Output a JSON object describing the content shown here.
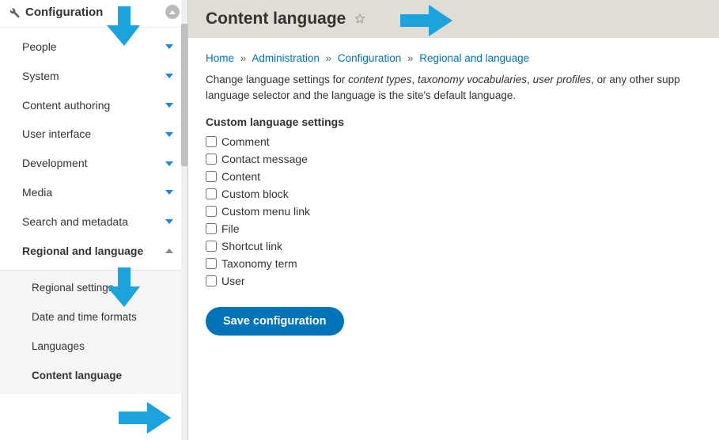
{
  "sidebar": {
    "title": "Configuration",
    "items": [
      {
        "label": "People"
      },
      {
        "label": "System"
      },
      {
        "label": "Content authoring"
      },
      {
        "label": "User interface"
      },
      {
        "label": "Development"
      },
      {
        "label": "Media"
      },
      {
        "label": "Search and metadata"
      },
      {
        "label": "Regional and language"
      }
    ],
    "sub": [
      {
        "label": "Regional settings"
      },
      {
        "label": "Date and time formats"
      },
      {
        "label": "Languages"
      },
      {
        "label": "Content language"
      }
    ]
  },
  "page": {
    "title": "Content language",
    "breadcrumb": {
      "home": "Home",
      "admin": "Administration",
      "config": "Configuration",
      "regional": "Regional and language",
      "sep": "»"
    },
    "desc_prefix": "Change language settings for ",
    "desc_em1": "content types",
    "desc_s1": ", ",
    "desc_em2": "taxonomy vocabularies",
    "desc_s2": ", ",
    "desc_em3": "user profiles",
    "desc_suffix": ", or any other supp",
    "desc_line2": "language selector and the language is the site's default language.",
    "section_title": "Custom language settings",
    "checks": [
      "Comment",
      "Contact message",
      "Content",
      "Custom block",
      "Custom menu link",
      "File",
      "Shortcut link",
      "Taxonomy term",
      "User"
    ],
    "save": "Save configuration"
  }
}
